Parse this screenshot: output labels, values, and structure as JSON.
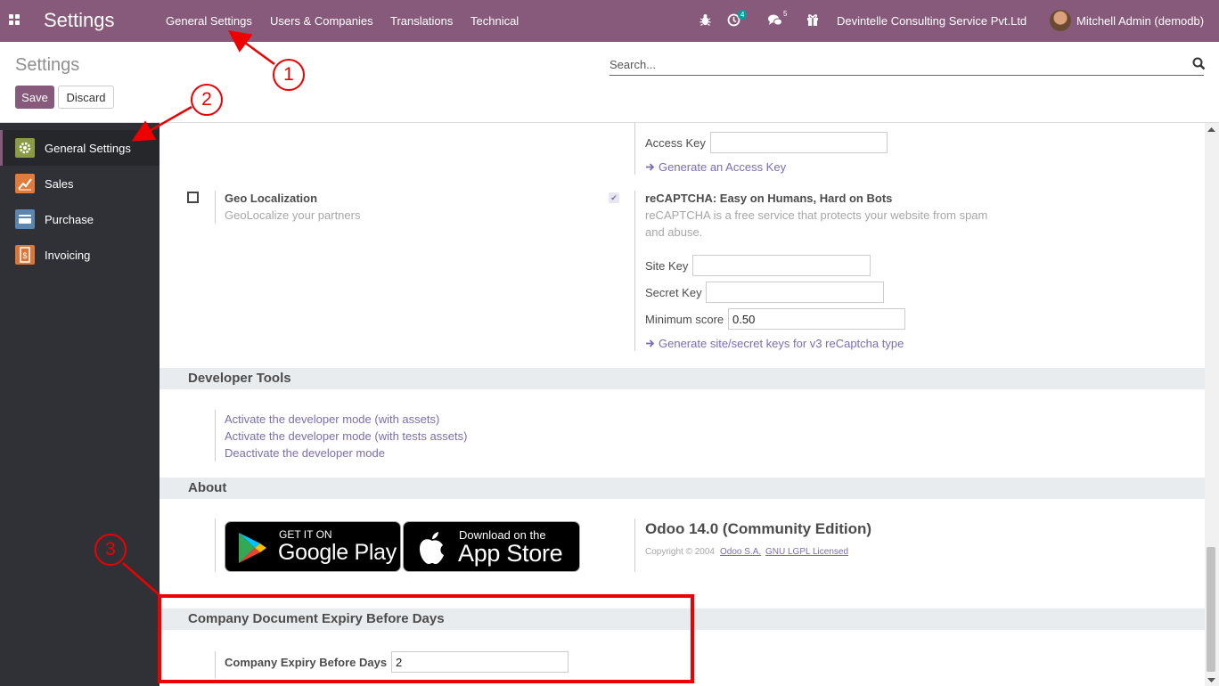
{
  "navbar": {
    "app_title": "Settings",
    "menus": [
      "General Settings",
      "Users & Companies",
      "Translations",
      "Technical"
    ],
    "activity_count": "4",
    "message_count": "5",
    "company": "Devintelle Consulting Service Pvt.Ltd",
    "user": "Mitchell Admin (demodb)"
  },
  "control_panel": {
    "title": "Settings",
    "save_label": "Save",
    "discard_label": "Discard",
    "search_placeholder": "Search..."
  },
  "sidebar": {
    "items": [
      {
        "label": "General Settings",
        "icon": "gear-icon",
        "color": "#8a9a45",
        "active": true
      },
      {
        "label": "Sales",
        "icon": "chart-icon",
        "color": "#e07b3c"
      },
      {
        "label": "Purchase",
        "icon": "card-icon",
        "color": "#5b86b0"
      },
      {
        "label": "Invoicing",
        "icon": "invoice-icon",
        "color": "#d9773a"
      }
    ]
  },
  "integrations": {
    "access_key_label": "Access Key",
    "access_key_value": "",
    "generate_access_key": "Generate an Access Key",
    "geo_title": "Geo Localization",
    "geo_desc": "GeoLocalize your partners",
    "geo_checked": false,
    "recaptcha_title": "reCAPTCHA: Easy on Humans, Hard on Bots",
    "recaptcha_desc_line1": "reCAPTCHA is a free service that protects your website from spam",
    "recaptcha_desc_line2": "and abuse.",
    "recaptcha_checked": true,
    "site_key_label": "Site Key",
    "site_key_value": "",
    "secret_key_label": "Secret Key",
    "secret_key_value": "",
    "min_score_label": "Minimum score",
    "min_score_value": "0.50",
    "generate_site_keys": "Generate site/secret keys for v3 reCaptcha type"
  },
  "developer_tools": {
    "heading": "Developer Tools",
    "links": [
      "Activate the developer mode (with assets)",
      "Activate the developer mode (with tests assets)",
      "Deactivate the developer mode"
    ]
  },
  "about": {
    "heading": "About",
    "google_play_small": "GET IT ON",
    "google_play_big": "Google Play",
    "app_store_small": "Download on the",
    "app_store_big": "App Store",
    "version": "Odoo 14.0 (Community Edition)",
    "copyright_prefix": "Copyright © 2004",
    "copyright_company": "Odoo S.A.",
    "license": "GNU LGPL Licensed"
  },
  "company_expiry": {
    "heading": "Company Document Expiry Before Days",
    "label": "Company Expiry Before Days",
    "value": "2"
  },
  "annotations": {
    "callout_1": "1",
    "callout_2": "2",
    "callout_3": "3",
    "color": "#e00000"
  },
  "colors": {
    "brand": "#875a7b",
    "link": "#7c6db0",
    "sidebar_bg": "#2f3136"
  }
}
